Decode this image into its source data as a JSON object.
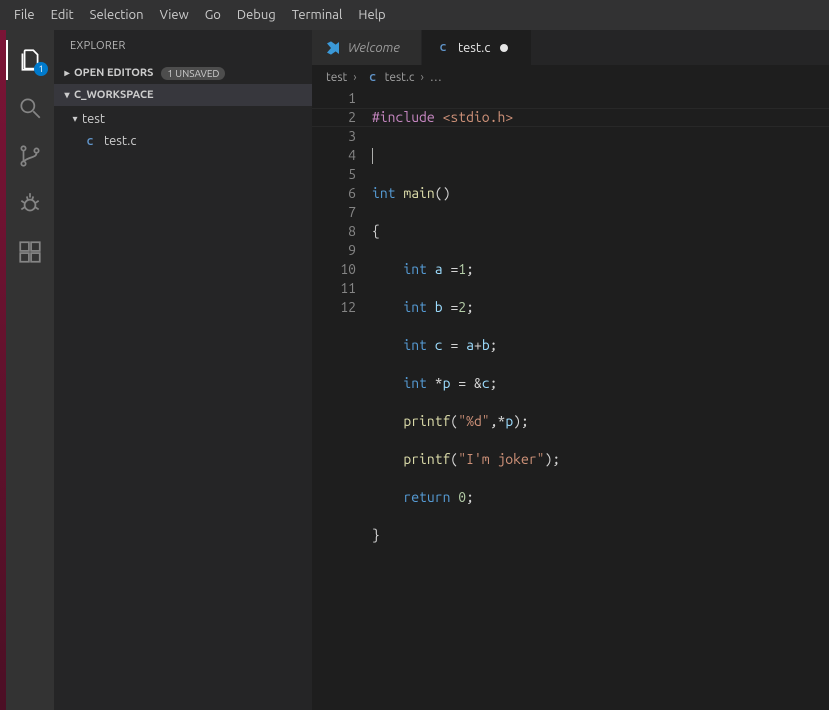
{
  "menu": {
    "items": [
      "File",
      "Edit",
      "Selection",
      "View",
      "Go",
      "Debug",
      "Terminal",
      "Help"
    ]
  },
  "activity": {
    "badge": "1"
  },
  "sidebar": {
    "title": "EXPLORER",
    "open_editors": {
      "label": "OPEN EDITORS",
      "unsaved": "1 UNSAVED"
    },
    "workspace": {
      "label": "C_WORKSPACE"
    },
    "tree": {
      "folder": {
        "name": "test"
      },
      "file": {
        "name": "test.c",
        "lang_badge": "C"
      }
    }
  },
  "tabs": {
    "welcome": {
      "label": "Welcome"
    },
    "file": {
      "label": "test.c",
      "lang_badge": "C"
    }
  },
  "breadcrumbs": {
    "seg0": "test",
    "seg1_badge": "C",
    "seg1": "test.c",
    "seg2": "…"
  },
  "code": {
    "line_count": 12,
    "tokens": {
      "include_kw": "#include",
      "include_hdr": "<stdio.h>",
      "int_kw": "int",
      "main_fn": "main",
      "a_var": "a",
      "b_var": "b",
      "c_var": "c",
      "p_var": "p",
      "printf_fn": "printf",
      "fmt_str": "\"%d\"",
      "joker_str": "\"I'm joker\"",
      "return_kw": "return",
      "eq": "=",
      "plus": "+",
      "amp": "&",
      "star": "*",
      "comma": ",",
      "semi": ";",
      "one": "1",
      "two": "2",
      "zero": "0",
      "lpar": "(",
      "rpar": ")",
      "lbrace": "{",
      "rbrace": "}"
    }
  }
}
